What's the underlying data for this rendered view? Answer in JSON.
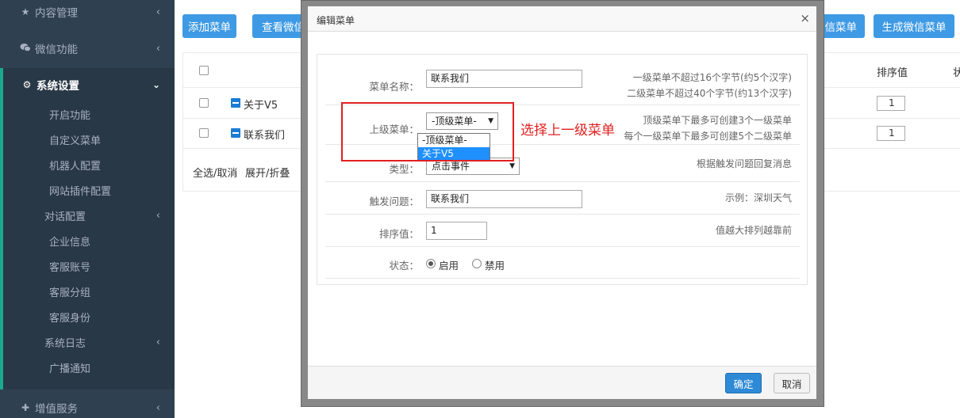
{
  "sidebar": {
    "content_mgmt": "内容管理",
    "wechat": "微信功能",
    "system": "系统设置",
    "items": [
      "开启功能",
      "自定义菜单",
      "机器人配置",
      "网站插件配置"
    ],
    "dialog_config": "对话配置",
    "items2": [
      "企业信息",
      "客服账号",
      "客服分组",
      "客服身份"
    ],
    "syslog": "系统日志",
    "broadcast": "广播通知",
    "value_added": "增值服务",
    "arrow_left": "‹",
    "arrow_down": "›"
  },
  "toolbar": {
    "add_menu": "添加菜单",
    "view_menu": "查看微信菜单",
    "wechat_menu_tail": "微信菜单",
    "gen_menu": "生成微信菜单"
  },
  "table": {
    "header_sort": "排序值",
    "header_cut": "状",
    "rows": [
      {
        "name": "关于V5",
        "sort": "1"
      },
      {
        "name": "联系我们",
        "sort": "1"
      }
    ],
    "footer_select": "全选/取消",
    "footer_expand": "展开/折叠"
  },
  "modal": {
    "title": "编辑菜单",
    "close": "×",
    "name_label": "菜单名称：",
    "name_value": "联系我们",
    "name_hint1": "一级菜单不超过16个字节(约5个汉字)",
    "name_hint2": "二级菜单不超过40个字节(约13个汉字)",
    "parent_label": "上级菜单：",
    "parent_value": "-顶级菜单-",
    "parent_options": [
      "-顶级菜单-",
      "关于V5"
    ],
    "parent_hint1": "顶级菜单下最多可创建3个一级菜单",
    "parent_hint2": "每个一级菜单下最多可创建5个二级菜单",
    "type_label": "类型：",
    "type_value": "点击事件",
    "type_hint": "根据触发问题回复消息",
    "trigger_label": "触发问题：",
    "trigger_value": "联系我们",
    "trigger_hint": "示例：深圳天气",
    "sort_label": "排序值：",
    "sort_value": "1",
    "sort_hint": "值越大排列越靠前",
    "status_label": "状态：",
    "status_on": "启用",
    "status_off": "禁用",
    "ok": "确定",
    "cancel": "取消"
  },
  "annotation": {
    "note": "选择上一级菜单",
    "color": "#e02020"
  },
  "colors": {
    "sidebar_bg": "#2f4050",
    "sidebar_active_bg": "#293846",
    "accent": "#19aa8d",
    "primary_button": "#3e9ae4",
    "ok_button": "#2e8ad6"
  }
}
